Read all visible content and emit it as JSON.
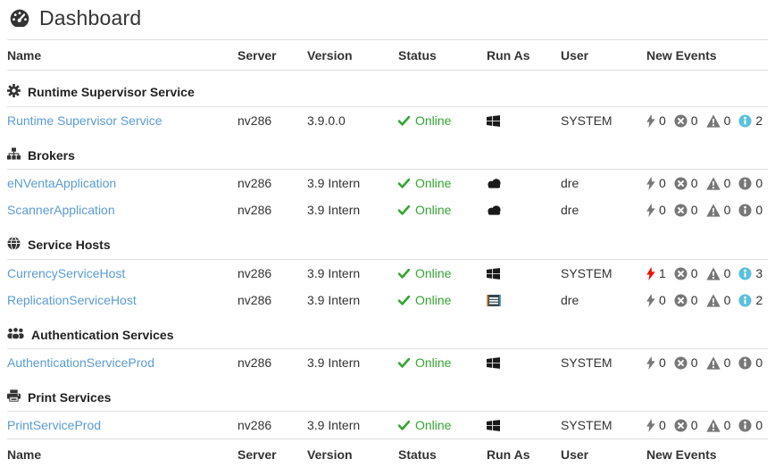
{
  "page": {
    "title": "Dashboard"
  },
  "table": {
    "headers": {
      "name": "Name",
      "server": "Server",
      "version": "Version",
      "status": "Status",
      "run_as": "Run As",
      "user": "User",
      "new_events": "New Events"
    },
    "sections": [
      {
        "label": "Runtime Supervisor Service",
        "icon": "gear-icon",
        "rows": [
          {
            "name": "Runtime Supervisor Service",
            "server": "nv286",
            "version": "3.9.0.0",
            "status": "Online",
            "run_as": "windows",
            "user": "SYSTEM",
            "events": {
              "flash": "0",
              "error": "0",
              "warning": "0",
              "info": "2"
            }
          }
        ]
      },
      {
        "label": "Brokers",
        "icon": "sitemap-icon",
        "rows": [
          {
            "name": "eNVentaApplication",
            "server": "nv286",
            "version": "3.9 Intern",
            "status": "Online",
            "run_as": "cloud",
            "user": "dre",
            "events": {
              "flash": "0",
              "error": "0",
              "warning": "0",
              "info": "0"
            }
          },
          {
            "name": "ScannerApplication",
            "server": "nv286",
            "version": "3.9 Intern",
            "status": "Online",
            "run_as": "cloud",
            "user": "dre",
            "events": {
              "flash": "0",
              "error": "0",
              "warning": "0",
              "info": "0"
            }
          }
        ]
      },
      {
        "label": "Service Hosts",
        "icon": "globe-icon",
        "rows": [
          {
            "name": "CurrencyServiceHost",
            "server": "nv286",
            "version": "3.9 Intern",
            "status": "Online",
            "run_as": "windows",
            "user": "SYSTEM",
            "events": {
              "flash": "1",
              "error": "0",
              "warning": "0",
              "info": "3"
            }
          },
          {
            "name": "ReplicationServiceHost",
            "server": "nv286",
            "version": "3.9 Intern",
            "status": "Online",
            "run_as": "console",
            "user": "dre",
            "events": {
              "flash": "0",
              "error": "0",
              "warning": "0",
              "info": "2"
            }
          }
        ]
      },
      {
        "label": "Authentication Services",
        "icon": "users-icon",
        "rows": [
          {
            "name": "AuthenticationServiceProd",
            "server": "nv286",
            "version": "3.9 Intern",
            "status": "Online",
            "run_as": "windows",
            "user": "SYSTEM",
            "events": {
              "flash": "0",
              "error": "0",
              "warning": "0",
              "info": "0"
            }
          }
        ]
      },
      {
        "label": "Print Services",
        "icon": "printer-icon",
        "rows": [
          {
            "name": "PrintServiceProd",
            "server": "nv286",
            "version": "3.9 Intern",
            "status": "Online",
            "run_as": "windows",
            "user": "SYSTEM",
            "events": {
              "flash": "0",
              "error": "0",
              "warning": "0",
              "info": "0"
            }
          }
        ]
      }
    ]
  },
  "colors": {
    "link": "#5b9bd5",
    "online_green": "#33a532",
    "event_inactive": "#777777",
    "event_info_active": "#5bc0de",
    "event_flash_active": "#e8130c",
    "console_icon_left_stripe": "#e09b3d",
    "console_icon_right_stripe": "#4aa3e0"
  }
}
